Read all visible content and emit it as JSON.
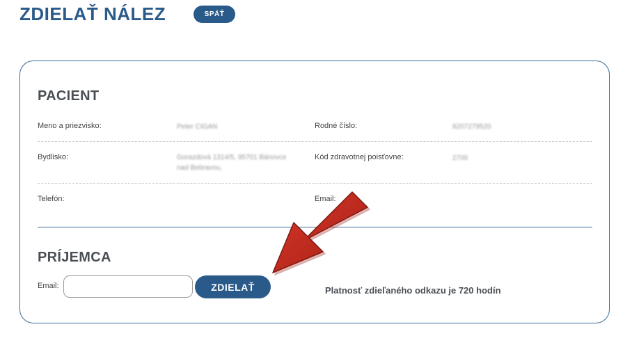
{
  "header": {
    "title": "ZDIELAŤ NÁLEZ",
    "back_label": "SPÄŤ"
  },
  "patient": {
    "heading": "PACIENT",
    "fields": {
      "name": {
        "label": "Meno a priezvisko:",
        "value": "Peter CIGAN"
      },
      "birth_number": {
        "label": "Rodné číslo:",
        "value": "8207279520"
      },
      "address": {
        "label": "Bydlisko:",
        "value_line1": "Gorazdová 1314/5, 95701 Bánovce",
        "value_line2": "nad Bebravou,"
      },
      "insurance": {
        "label": "Kód zdravotnej poisťovne:",
        "value": "2700"
      },
      "phone": {
        "label": "Telefón:"
      },
      "email": {
        "label": "Email:"
      }
    }
  },
  "recipient": {
    "heading": "PRÍJEMCA",
    "email_label": "Email:",
    "email_value": "",
    "email_placeholder": "",
    "share_label": "ZDIELAŤ",
    "validity_note": "Platnosť zdieľaného odkazu je 720 hodín"
  },
  "colors": {
    "primary": "#2a5a8a",
    "border": "#3e6a95",
    "heading": "#4a4f55",
    "arrow": "#c0281c"
  },
  "icons": [
    "red-arrow-annotation-icon"
  ]
}
